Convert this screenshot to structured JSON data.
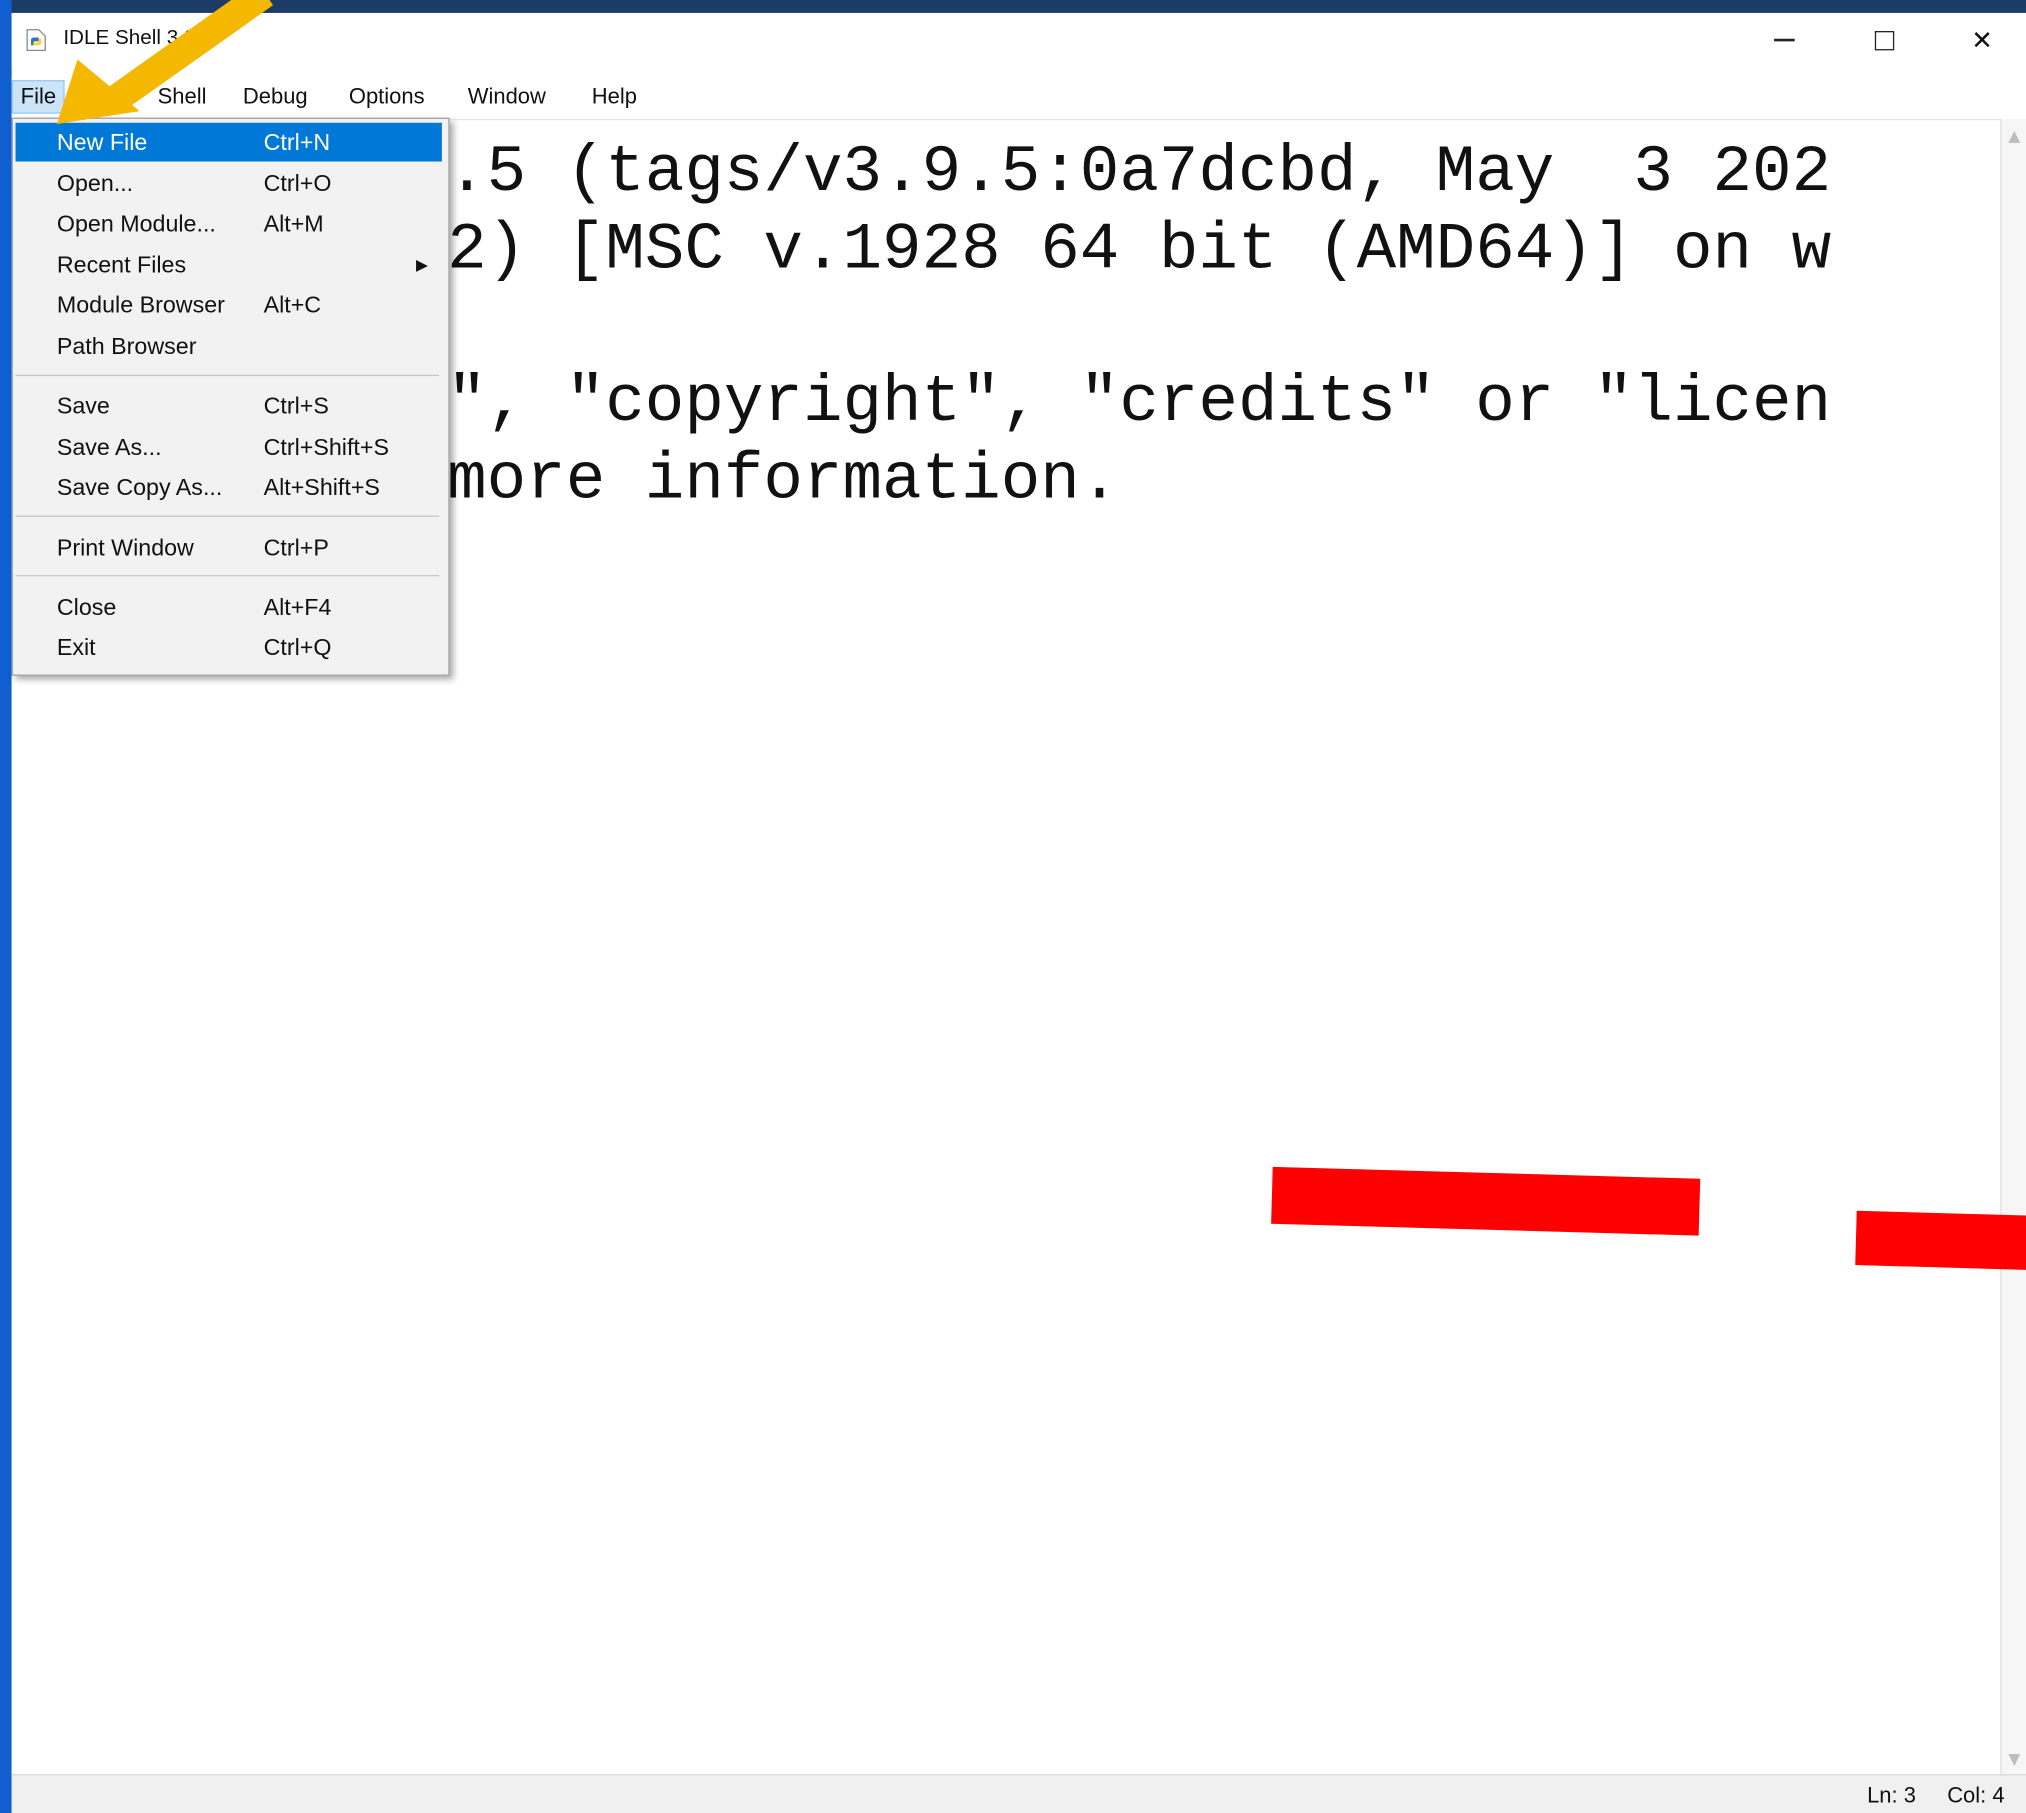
{
  "window": {
    "title": "IDLE Shell 3.9.5",
    "minimize_icon": "minimize-icon",
    "maximize_icon": "maximize-icon",
    "close_glyph": "✕"
  },
  "menubar": {
    "items": [
      "File",
      "Edit",
      "Shell",
      "Debug",
      "Options",
      "Window",
      "Help"
    ]
  },
  "editor": {
    "lines": [
      ".5 (tags/v3.9.5:0a7dcbd, May  3 202",
      "2) [MSC v.1928 64 bit (AMD64)] on w",
      "\", \"copyright\", \"credits\" or \"licen",
      "more information."
    ]
  },
  "file_menu": {
    "items": [
      {
        "label": "New File",
        "accel": "Ctrl+N"
      },
      {
        "label": "Open...",
        "accel": "Ctrl+O"
      },
      {
        "label": "Open Module...",
        "accel": "Alt+M"
      },
      {
        "label": "Recent Files",
        "accel": "",
        "submenu_glyph": "▶"
      },
      {
        "label": "Module Browser",
        "accel": "Alt+C"
      },
      {
        "label": "Path Browser",
        "accel": ""
      },
      {
        "label": "Save",
        "accel": "Ctrl+S"
      },
      {
        "label": "Save As...",
        "accel": "Ctrl+Shift+S"
      },
      {
        "label": "Save Copy As...",
        "accel": "Alt+Shift+S"
      },
      {
        "label": "Print Window",
        "accel": "Ctrl+P"
      },
      {
        "label": "Close",
        "accel": "Alt+F4"
      },
      {
        "label": "Exit",
        "accel": "Ctrl+Q"
      }
    ]
  },
  "status": {
    "line": "Ln: 3",
    "col": "Col: 4"
  },
  "colors": {
    "highlight": "#0078d7",
    "annotation_arrow": "#f5b800",
    "annotation_dash": "#ff0000"
  }
}
